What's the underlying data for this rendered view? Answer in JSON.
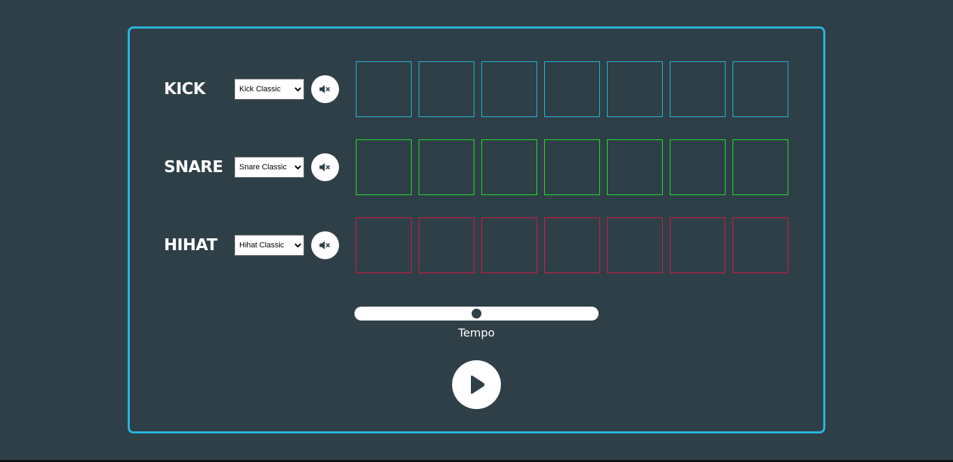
{
  "colors": {
    "background": "#2f3f47",
    "frame": "#25b9e0",
    "kick": "#25b9e0",
    "snare": "#22e52a",
    "hihat": "#d71a45",
    "control": "#ffffff"
  },
  "tracks": [
    {
      "label": "KICK",
      "selected_sound": "Kick Classic",
      "color": "#25b9e0",
      "pad_count": 7,
      "mute_icon": "volume-mute-icon"
    },
    {
      "label": "SNARE",
      "selected_sound": "Snare Classic",
      "color": "#22e52a",
      "pad_count": 7,
      "mute_icon": "volume-mute-icon"
    },
    {
      "label": "HIHAT",
      "selected_sound": "Hihat Classic",
      "color": "#d71a45",
      "pad_count": 7,
      "mute_icon": "volume-mute-icon"
    }
  ],
  "tempo": {
    "label": "Tempo",
    "value_fraction": 0.5
  },
  "play": {
    "icon": "play-icon"
  }
}
